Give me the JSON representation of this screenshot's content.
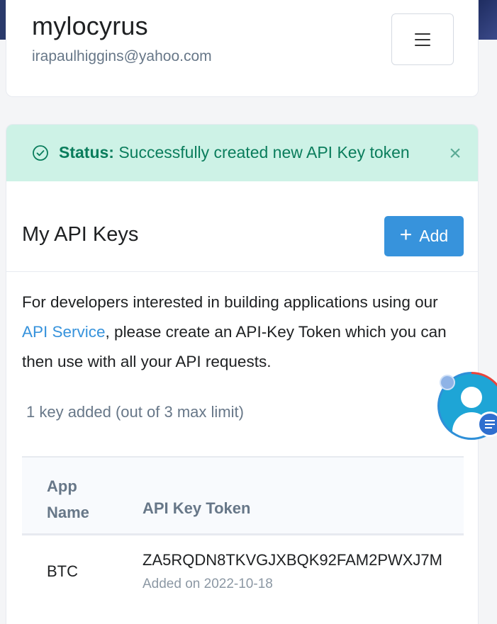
{
  "profile": {
    "username": "mylocyrus",
    "email": "irapaulhiggins@yahoo.com",
    "menu_icon": "hamburger-menu-icon"
  },
  "alert": {
    "icon": "check-circle-icon",
    "label": "Status:",
    "message": "Successfully created new API Key token",
    "close_icon": "close-icon",
    "close_glyph": "×"
  },
  "api_keys": {
    "title": "My API Keys",
    "add_button": {
      "icon": "plus-icon",
      "glyph": "+",
      "label": "Add"
    },
    "description": {
      "before_link": "For developers interested in building applications using our ",
      "link_text": "API Service",
      "after_link": ", please create an API-Key Token which you can then use with all your API requests."
    },
    "key_count": "1 key added (out of 3 max limit)",
    "table": {
      "columns": [
        "App Name",
        "API Key Token"
      ],
      "rows": [
        {
          "app_name": "BTC",
          "token": "ZA5RQDN8TKVGJXBQK92FAM2PWXJ7M",
          "added": "Added on 2022-10-18"
        }
      ]
    }
  },
  "chat_widget": {
    "icon": "chat-support-avatar-icon"
  },
  "colors": {
    "accent": "#3793dc",
    "success_bg": "#cdf2e6",
    "success_text": "#0a7d5c"
  }
}
